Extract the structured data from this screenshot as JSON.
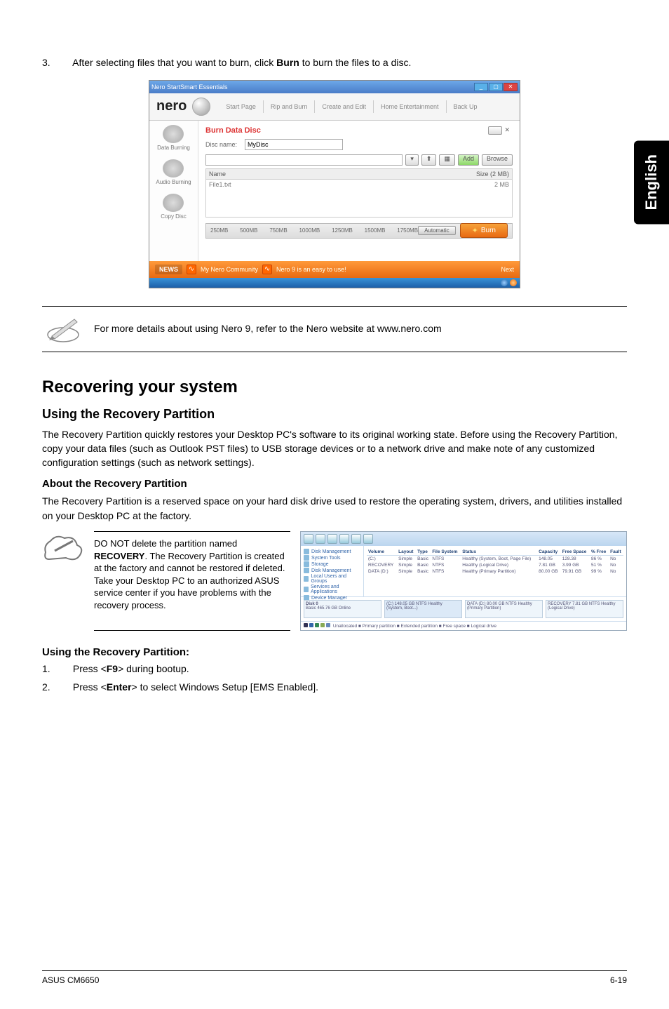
{
  "sideTab": "English",
  "step3": {
    "num": "3.",
    "text_before": "After selecting files that you want to burn, click ",
    "bold": "Burn",
    "text_after": " to burn the files to a disc."
  },
  "nero": {
    "titlebar": "Nero StartSmart Essentials",
    "logo": "nero",
    "tabs": [
      "Start Page",
      "Rip and Burn",
      "Create and Edit",
      "Home Entertainment",
      "Back Up"
    ],
    "sideItems": [
      "Data Burning",
      "Audio Burning",
      "Copy Disc"
    ],
    "burnTitle": "Burn Data Disc",
    "discNameLabel": "Disc name:",
    "discNameValue": "MyDisc",
    "addBtn": "Add",
    "browseBtn": "Browse",
    "listName": "Name",
    "listSize": "Size (2 MB)",
    "listItem": "File1.txt",
    "listItemSize": "2 MB",
    "ticks": [
      "250MB",
      "500MB",
      "750MB",
      "1000MB",
      "1250MB",
      "1500MB",
      "1750MB"
    ],
    "autoLabel": "Automatic",
    "burnBtn": "Burn",
    "newsLabel": "NEWS",
    "news1": "My Nero Community",
    "news2": "Nero 9 is an easy to use!",
    "nextLabel": "Next"
  },
  "note": "For more details about using Nero 9, refer to the Nero website at www.nero.com",
  "h2": "Recovering your system",
  "h3": "Using the Recovery Partition",
  "para1": "The Recovery Partition quickly restores your Desktop PC's software to its original working state. Before using the Recovery Partition, copy your data files (such as Outlook PST files) to USB storage devices or to a network drive and make note of any customized configuration settings (such as network settings).",
  "h4": "About the Recovery Partition",
  "para2": "The Recovery Partition is a reserved space on your hard disk drive used to restore the operating system, drivers, and utilities installed on your Desktop PC at the factory.",
  "warn": {
    "p1a": "DO NOT delete the partition named ",
    "p1b": "RECOVERY",
    "p1c": ". The Recovery Partition is created at the factory and cannot be restored if deleted. Take your Desktop PC to an authorized ASUS service center if you have problems with the recovery process."
  },
  "disk": {
    "leftItems": [
      "Disk Management",
      "System Tools",
      "Storage",
      "Disk Management",
      "Local Users and Groups",
      "Services and Applications",
      "Device Manager"
    ],
    "cols": [
      "Volume",
      "Layout",
      "Type",
      "File System",
      "Status",
      "Capacity",
      "Free Space",
      "% Free",
      "Fault"
    ],
    "rows": [
      [
        "(C:)",
        "Simple",
        "Basic",
        "NTFS",
        "Healthy (System, Boot, Page File)",
        "148.05",
        "128.38",
        "86 %",
        "No"
      ],
      [
        "RECOVERY",
        "Simple",
        "Basic",
        "NTFS",
        "Healthy (Logical Drive)",
        "7.81 GB",
        "3.99 GB",
        "51 %",
        "No"
      ],
      [
        "DATA (D:)",
        "Simple",
        "Basic",
        "NTFS",
        "Healthy (Primary Partition)",
        "80.00 GB",
        "79.91 GB",
        "99 %",
        "No"
      ]
    ],
    "disk0": "Disk 0",
    "disk0b": "Basic\n465.76 GB\nOnline",
    "part1": "(C:)\n148.05 GB NTFS\nHealthy (System, Boot...)",
    "part2": "DATA (D:)\n80.00 GB NTFS\nHealthy (Primary Partition)",
    "part3": "RECOVERY\n7.81 GB NTFS\nHealthy (Logical Drive)",
    "status": "Unallocated ■ Primary partition ■ Extended partition ■ Free space ■ Logical drive"
  },
  "h4b": "Using the Recovery Partition:",
  "step1": {
    "num": "1.",
    "a": "Press <",
    "b": "F9",
    "c": "> during bootup."
  },
  "step2": {
    "num": "2.",
    "a": "Press <",
    "b": "Enter",
    "c": "> to select Windows Setup [EMS Enabled]."
  },
  "footerLeft": "ASUS CM6650",
  "footerRight": "6-19"
}
